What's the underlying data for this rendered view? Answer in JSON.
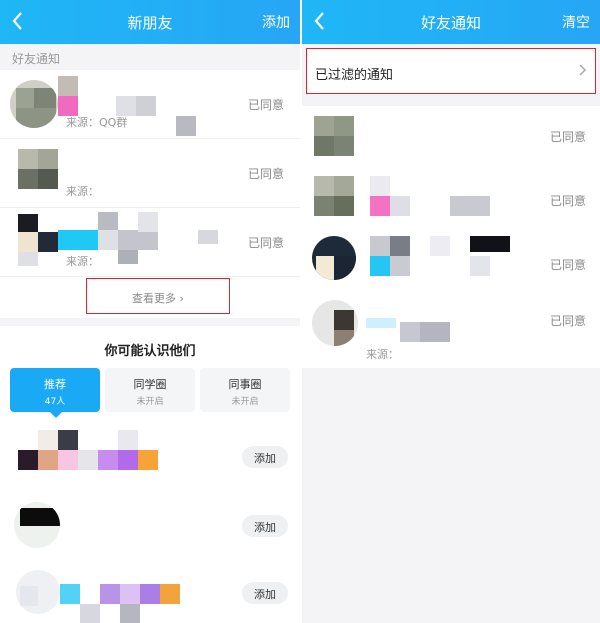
{
  "left": {
    "nav": {
      "title": "新朋友",
      "action": "添加"
    },
    "section_label": "好友通知",
    "notifications": [
      {
        "source": "来源：QQ群",
        "status": "已同意"
      },
      {
        "source": "来源：",
        "status": "已同意"
      },
      {
        "source": "来源：",
        "status": "已同意"
      }
    ],
    "see_more": "查看更多",
    "may_know": {
      "title": "你可能认识他们",
      "tabs": [
        {
          "name": "推荐",
          "sub": "47人"
        },
        {
          "name": "同学圈",
          "sub": "未开启"
        },
        {
          "name": "同事圈",
          "sub": "未开启"
        }
      ],
      "add_label": "添加"
    },
    "colors": {
      "nav_start": "#1fb7f6",
      "nav_end": "#26a6f5",
      "highlight_border": "#d9262c",
      "tab_active": "#1aa9f4"
    }
  },
  "right": {
    "nav": {
      "title": "好友通知",
      "action": "清空"
    },
    "filtered_label": "已过滤的通知",
    "notifications": [
      {
        "status": "已同意"
      },
      {
        "status": "已同意"
      },
      {
        "status": "已同意"
      },
      {
        "status": "已同意",
        "source": "来源："
      }
    ]
  }
}
